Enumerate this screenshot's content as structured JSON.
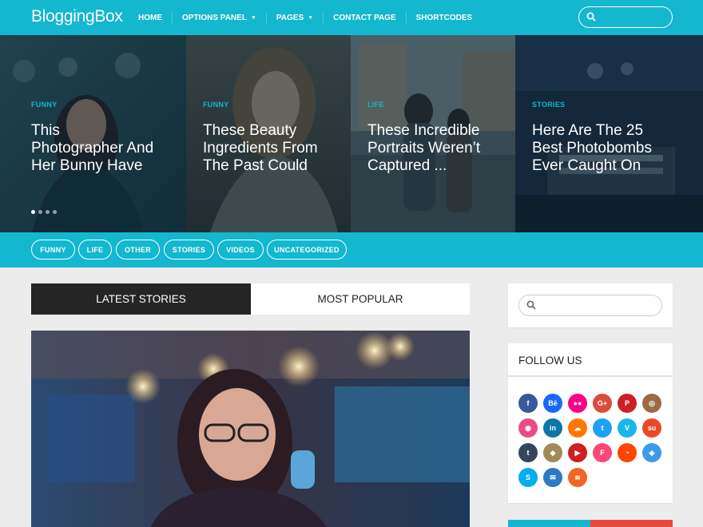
{
  "header": {
    "logo": "BloggingBox",
    "nav": [
      {
        "label": "HOME",
        "caret": false
      },
      {
        "label": "OPTIONS PANEL",
        "caret": true
      },
      {
        "label": "PAGES",
        "caret": true
      },
      {
        "label": "CONTACT PAGE",
        "caret": false
      },
      {
        "label": "SHORTCODES",
        "caret": false
      }
    ],
    "search_placeholder": ""
  },
  "slides": [
    {
      "category": "FUNNY",
      "title_lines": [
        "This",
        "Photographer And",
        "Her Bunny Have"
      ]
    },
    {
      "category": "FUNNY",
      "title_lines": [
        "These Beauty",
        "Ingredients From",
        "The Past Could"
      ]
    },
    {
      "category": "LIFE",
      "title_lines": [
        "These Incredible",
        "Portraits Weren’t",
        "Captured ..."
      ]
    },
    {
      "category": "STORIES",
      "title_lines": [
        "Here Are The 25",
        "Best Photobombs",
        "Ever Caught On"
      ]
    }
  ],
  "slider_dots": {
    "count": 4,
    "active": 1
  },
  "categories": [
    "FUNNY",
    "LIFE",
    "OTHER",
    "STORIES",
    "VIDEOS",
    "UNCATEGORIZED"
  ],
  "tabs": {
    "latest": "LATEST STORIES",
    "popular": "MOST POPULAR"
  },
  "sidebar": {
    "search_placeholder": "",
    "follow_title": "FOLLOW US",
    "social": [
      {
        "name": "facebook-icon",
        "glyph": "f",
        "color": "#3b5998"
      },
      {
        "name": "behance-icon",
        "glyph": "Bē",
        "color": "#1769ff"
      },
      {
        "name": "flickr-icon",
        "glyph": "●●",
        "color": "#ff0084"
      },
      {
        "name": "google-plus-icon",
        "glyph": "G+",
        "color": "#dd4b39"
      },
      {
        "name": "pinterest-icon",
        "glyph": "P",
        "color": "#cb2027"
      },
      {
        "name": "instagram-icon",
        "glyph": "◎",
        "color": "#9c6b45"
      },
      {
        "name": "dribbble-icon",
        "glyph": "◉",
        "color": "#ea4c89"
      },
      {
        "name": "linkedin-icon",
        "glyph": "in",
        "color": "#0e76a8"
      },
      {
        "name": "soundcloud-icon",
        "glyph": "☁",
        "color": "#ff7700"
      },
      {
        "name": "twitter-icon",
        "glyph": "t",
        "color": "#1da1f2"
      },
      {
        "name": "vimeo-icon",
        "glyph": "V",
        "color": "#1ab7ea"
      },
      {
        "name": "stumbleupon-icon",
        "glyph": "su",
        "color": "#eb4924"
      },
      {
        "name": "tumblr-icon",
        "glyph": "t",
        "color": "#35465c"
      },
      {
        "name": "github-icon",
        "glyph": "◆",
        "color": "#a08a5a"
      },
      {
        "name": "youtube-icon",
        "glyph": "▶",
        "color": "#cd201f"
      },
      {
        "name": "foursquare-icon",
        "glyph": "F",
        "color": "#f94877"
      },
      {
        "name": "reddit-icon",
        "glyph": "◔",
        "color": "#ff4500"
      },
      {
        "name": "dropbox-icon",
        "glyph": "◈",
        "color": "#3d9ae8"
      },
      {
        "name": "skype-icon",
        "glyph": "S",
        "color": "#00aff0"
      },
      {
        "name": "email-icon",
        "glyph": "✉",
        "color": "#2c7bc0"
      },
      {
        "name": "rss-icon",
        "glyph": "≋",
        "color": "#f26522"
      }
    ]
  },
  "colors": {
    "accent": "#13b7cf",
    "dark_tab": "#252525",
    "red": "#e84a3e"
  }
}
